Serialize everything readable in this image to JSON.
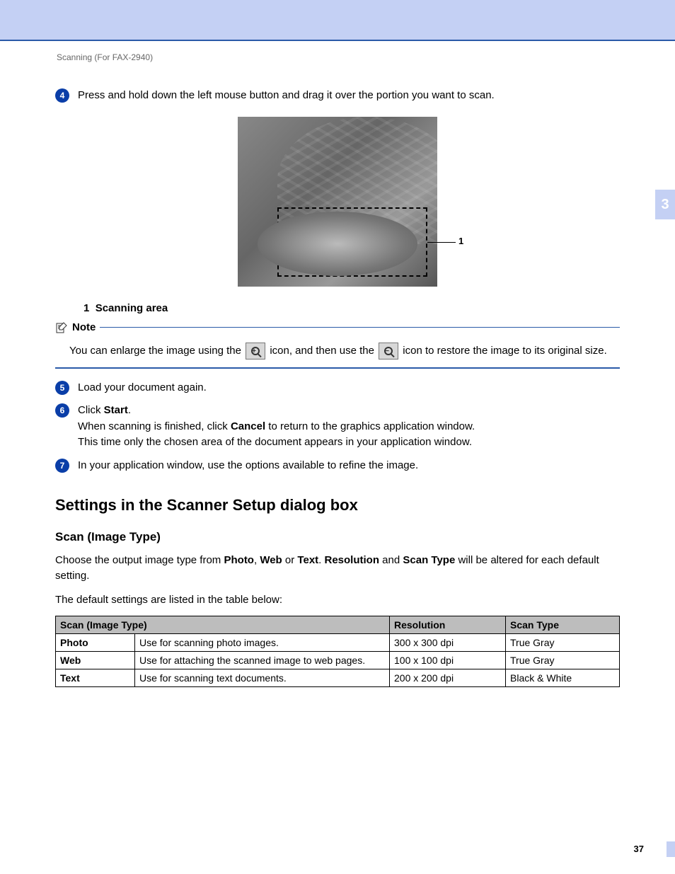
{
  "running_head": "Scanning (For FAX-2940)",
  "chapter_tab": "3",
  "steps": {
    "s4": {
      "num": "4",
      "text": "Press and hold down the left mouse button and drag it over the portion you want to scan."
    },
    "s5": {
      "num": "5",
      "text": "Load your document again."
    },
    "s6": {
      "num": "6",
      "line1_a": "Click ",
      "line1_b": "Start",
      "line1_c": ".",
      "line2_a": "When scanning is finished, click ",
      "line2_b": "Cancel",
      "line2_c": " to return to the graphics application window.",
      "line3": "This time only the chosen area of the document appears in your application window."
    },
    "s7": {
      "num": "7",
      "text": "In your application window, use the options available to refine the image."
    }
  },
  "figure": {
    "callout_num": "1",
    "caption_num": "1",
    "caption_text": "Scanning area"
  },
  "note": {
    "label": "Note",
    "text_a": "You can enlarge the image using the ",
    "text_b": " icon, and then use the ",
    "text_c": " icon to restore the image to its original size."
  },
  "section_heading": "Settings in the Scanner Setup dialog box",
  "subsection_heading": "Scan (Image Type)",
  "para1": {
    "a": "Choose the output image type from ",
    "b1": "Photo",
    "c1": ", ",
    "b2": "Web",
    "c2": " or ",
    "b3": "Text",
    "c3": ". ",
    "b4": "Resolution",
    "c4": " and ",
    "b5": "Scan Type",
    "c5": " will be altered for each default setting."
  },
  "para2": "The default settings are listed in the table below:",
  "table": {
    "headers": {
      "h1": "Scan (Image Type)",
      "h2": "Resolution",
      "h3": "Scan Type"
    },
    "rows": [
      {
        "name": "Photo",
        "desc": "Use for scanning photo images.",
        "res": "300 x 300 dpi",
        "type": "True Gray"
      },
      {
        "name": "Web",
        "desc": "Use for attaching the scanned image to web pages.",
        "res": "100 x 100 dpi",
        "type": "True Gray"
      },
      {
        "name": "Text",
        "desc": "Use for scanning text documents.",
        "res": "200 x 200 dpi",
        "type": "Black & White"
      }
    ]
  },
  "page_number": "37"
}
